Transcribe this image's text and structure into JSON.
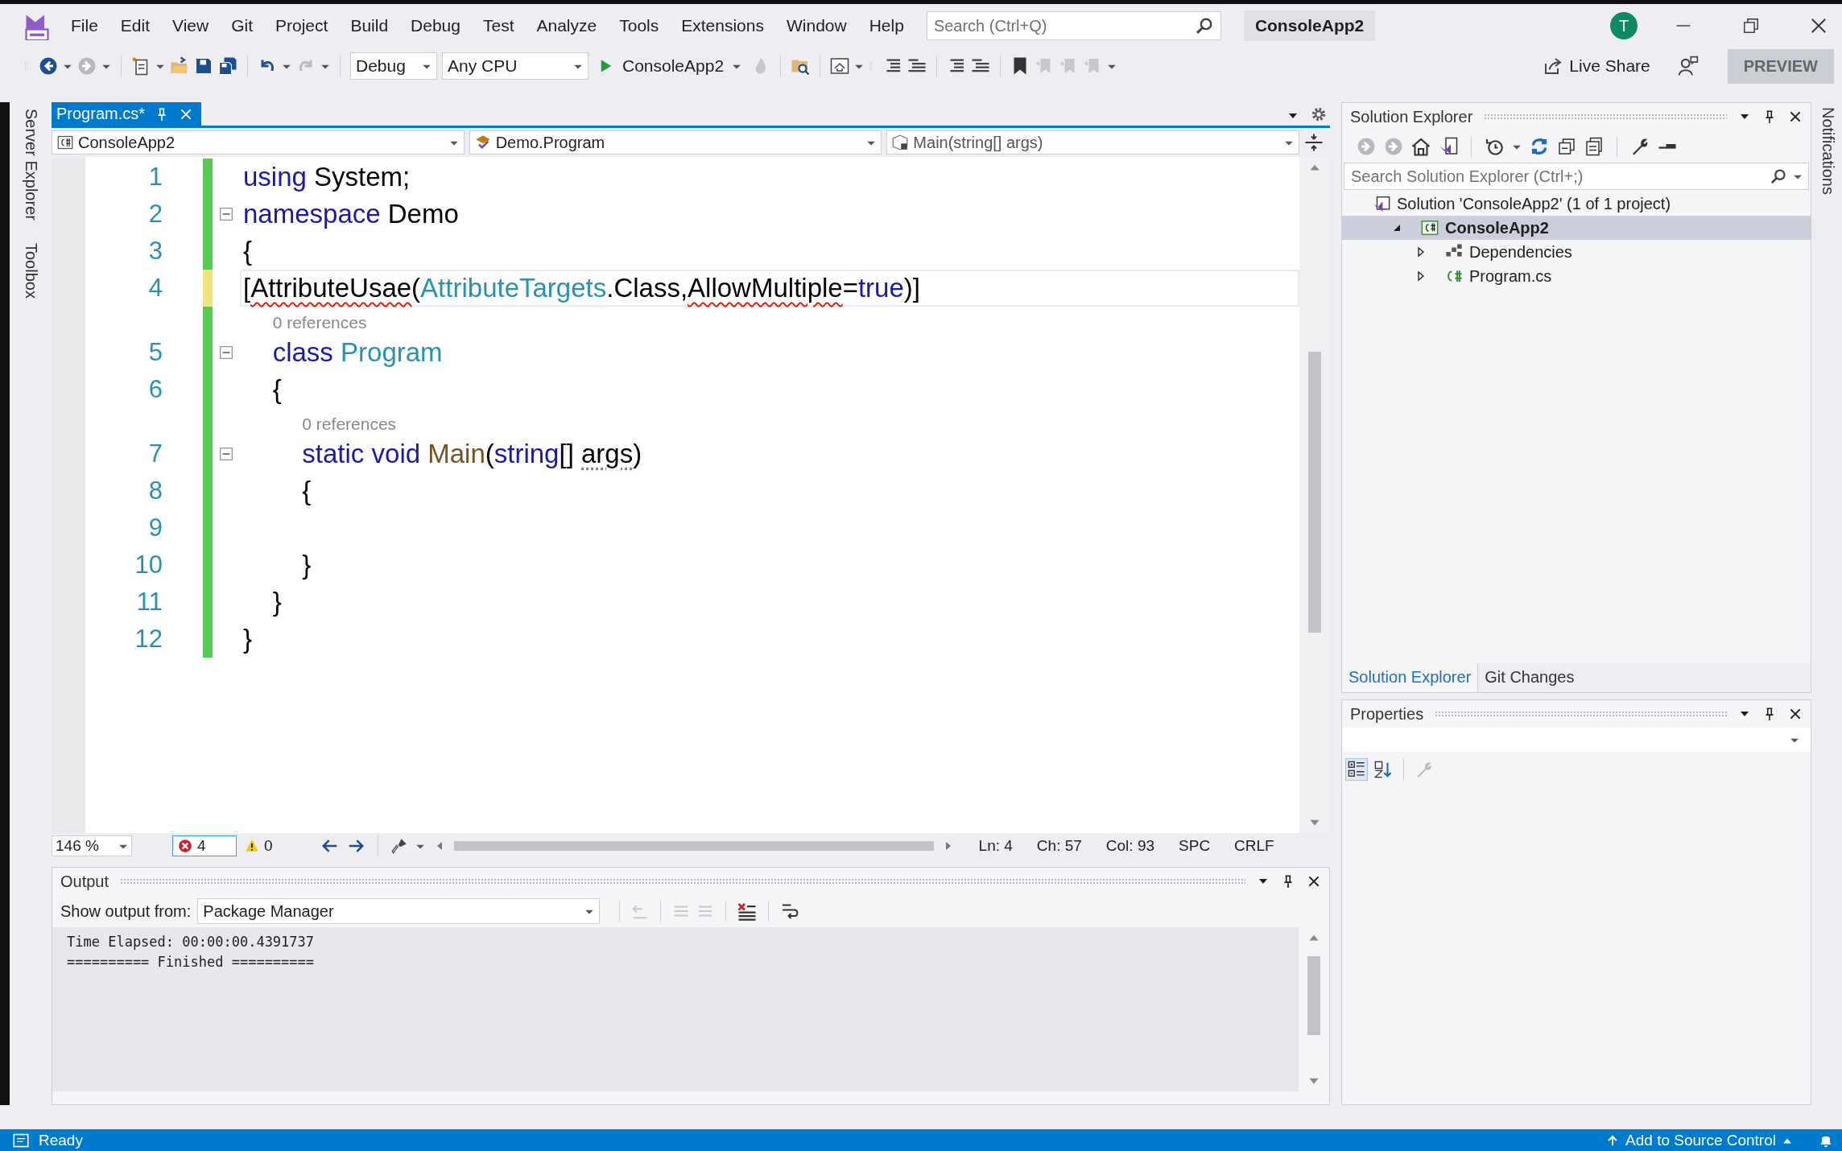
{
  "menu": {
    "items": [
      "File",
      "Edit",
      "View",
      "Git",
      "Project",
      "Build",
      "Debug",
      "Test",
      "Analyze",
      "Tools",
      "Extensions",
      "Window",
      "Help"
    ]
  },
  "search": {
    "placeholder": "Search (Ctrl+Q)"
  },
  "window": {
    "title": "ConsoleApp2"
  },
  "account": {
    "initial": "T"
  },
  "toolbar": {
    "configuration": "Debug",
    "platform": "Any CPU",
    "start_target": "ConsoleApp2",
    "live_share": "Live Share",
    "preview": "PREVIEW"
  },
  "left_strip": [
    "Server Explorer",
    "Toolbox"
  ],
  "editor": {
    "tabs": [
      {
        "label": "Program.cs*",
        "selected": true
      }
    ],
    "nav": [
      "ConsoleApp2",
      "Demo.Program",
      "Main(string[] args)"
    ],
    "lines": [
      {
        "kind": "code",
        "number": "1",
        "color": "#57c857",
        "fold": false,
        "current": false,
        "tokens": [
          {
            "text": "using",
            "kind": "keyword"
          },
          {
            "text": " System;",
            "kind": "plain"
          }
        ]
      },
      {
        "kind": "code",
        "number": "2",
        "color": "#57c857",
        "fold": true,
        "current": false,
        "tokens": [
          {
            "text": "namespace",
            "kind": "keyword"
          },
          {
            "text": " Demo",
            "kind": "plain"
          }
        ]
      },
      {
        "kind": "code",
        "number": "3",
        "color": "#57c857",
        "fold": false,
        "current": false,
        "tokens": [
          {
            "text": "{",
            "kind": "plain"
          }
        ]
      },
      {
        "kind": "code",
        "number": "4",
        "color": "#eee37c",
        "fold": false,
        "current": true,
        "tokens": [
          {
            "text": "[",
            "kind": "plain"
          },
          {
            "text": "AttributeUsae",
            "kind": "error"
          },
          {
            "text": "(",
            "kind": "plain"
          },
          {
            "text": "AttributeTargets",
            "kind": "type"
          },
          {
            "text": ".Class,",
            "kind": "plain"
          },
          {
            "text": "AllowMultiple",
            "kind": "error"
          },
          {
            "text": "=",
            "kind": "plain"
          },
          {
            "text": "true",
            "kind": "keyword"
          },
          {
            "text": ")]",
            "kind": "plain"
          }
        ]
      },
      {
        "kind": "codelens",
        "text": "0 references"
      },
      {
        "kind": "code",
        "number": "5",
        "color": "#57c857",
        "fold": true,
        "current": false,
        "tokens": [
          {
            "text": "    class",
            "kind": "keyword"
          },
          {
            "text": " Program",
            "kind": "type"
          }
        ]
      },
      {
        "kind": "code",
        "number": "6",
        "color": "#57c857",
        "fold": false,
        "current": false,
        "tokens": [
          {
            "text": "    {",
            "kind": "plain"
          }
        ]
      },
      {
        "kind": "codelens",
        "text": "0 references"
      },
      {
        "kind": "code",
        "number": "7",
        "color": "#57c857",
        "fold": true,
        "current": false,
        "tokens": [
          {
            "text": "        static void",
            "kind": "keyword"
          },
          {
            "text": " Main",
            "kind": "method"
          },
          {
            "text": "(",
            "kind": "plain"
          },
          {
            "text": "string",
            "kind": "keyword"
          },
          {
            "text": "[] ",
            "kind": "plain"
          },
          {
            "text": "args",
            "kind": "unused"
          },
          {
            "text": ")",
            "kind": "plain"
          }
        ]
      },
      {
        "kind": "code",
        "number": "8",
        "color": "#57c857",
        "fold": false,
        "current": false,
        "tokens": [
          {
            "text": "        {",
            "kind": "plain"
          }
        ]
      },
      {
        "kind": "code",
        "number": "9",
        "color": "#57c857",
        "fold": false,
        "current": false
      },
      {
        "kind": "code",
        "number": "10",
        "color": "#57c857",
        "fold": false,
        "current": false,
        "tokens": [
          {
            "text": "        }",
            "kind": "plain"
          }
        ]
      },
      {
        "kind": "code",
        "number": "11",
        "color": "#57c857",
        "fold": false,
        "current": false,
        "tokens": [
          {
            "text": "    }",
            "kind": "plain"
          }
        ]
      },
      {
        "kind": "code",
        "number": "12",
        "color": "#57c857",
        "fold": false,
        "current": false,
        "tokens": [
          {
            "text": "}",
            "kind": "plain"
          }
        ]
      }
    ],
    "zoom": "146 %",
    "errors": "4",
    "warnings": "0",
    "position": [
      "Ln: 4",
      "Ch: 57",
      "Col: 93",
      "SPC",
      "CRLF"
    ]
  },
  "output": {
    "title": "Output",
    "source_label": "Show output from:",
    "source": "Package Manager",
    "lines": [
      "Time Elapsed: 00:00:00.4391737",
      "========== Finished =========="
    ]
  },
  "solution_explorer": {
    "title": "Solution Explorer",
    "search_placeholder": "Search Solution Explorer (Ctrl+;)",
    "tree": [
      {
        "label": "Solution 'ConsoleApp2' (1 of 1 project)",
        "kind": "solution",
        "selected": false,
        "children": [
          {
            "label": "ConsoleApp2",
            "kind": "project",
            "expanded": true,
            "selected": true,
            "children": [
              {
                "label": "Dependencies",
                "kind": "dependencies",
                "expanded": false,
                "selected": false
              },
              {
                "label": "Program.cs",
                "kind": "csharp",
                "expanded": false,
                "selected": false
              }
            ]
          }
        ]
      }
    ],
    "tabs": [
      {
        "label": "Solution Explorer",
        "selected": true
      },
      {
        "label": "Git Changes",
        "selected": false
      }
    ]
  },
  "properties": {
    "title": "Properties"
  },
  "right_strip": [
    "Notifications"
  ],
  "status_bar": {
    "message": "Ready",
    "source_control": "Add to Source Control"
  }
}
